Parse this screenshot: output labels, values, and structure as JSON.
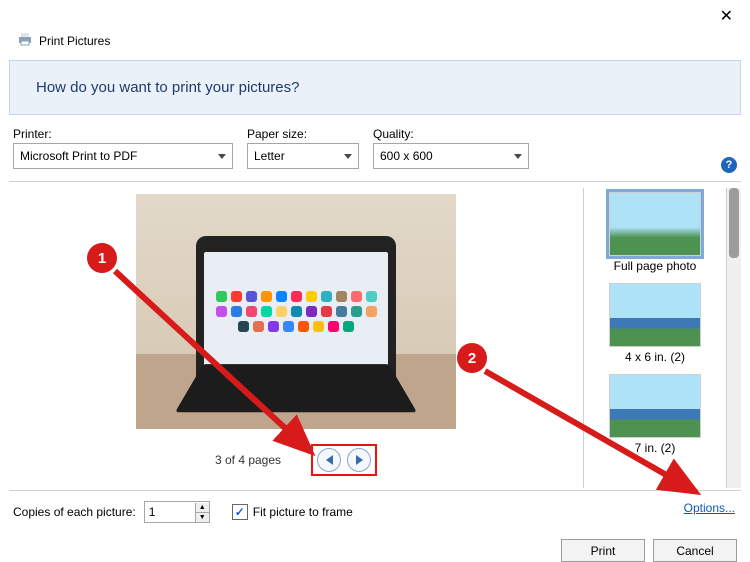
{
  "window": {
    "title": "Print Pictures"
  },
  "banner": {
    "heading": "How do you want to print your pictures?"
  },
  "printer": {
    "label": "Printer:",
    "value": "Microsoft Print to PDF"
  },
  "paper_size": {
    "label": "Paper size:",
    "value": "Letter"
  },
  "quality": {
    "label": "Quality:",
    "value": "600 x 600"
  },
  "pager": {
    "text": "3 of 4 pages"
  },
  "layouts": {
    "full": "Full page photo",
    "four_by_six": "4 x 6 in. (2)",
    "five_by_seven": "7 in. (2)"
  },
  "copies": {
    "label": "Copies of each picture:",
    "value": "1"
  },
  "fit": {
    "label": "Fit picture to frame",
    "checked": true
  },
  "options_link": "Options...",
  "buttons": {
    "print": "Print",
    "cancel": "Cancel"
  },
  "annotations": {
    "one": "1",
    "two": "2"
  }
}
